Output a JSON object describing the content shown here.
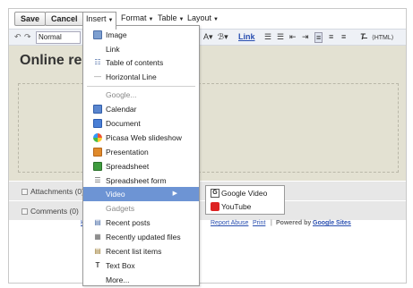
{
  "topbar": {
    "save_label": "Save",
    "cancel_label": "Cancel",
    "menus": [
      "Insert",
      "Format",
      "Table",
      "Layout"
    ]
  },
  "toolbar": {
    "undo_icon": "undo-icon",
    "redo_icon": "redo-icon",
    "style_value": "Normal",
    "link_label": "Link"
  },
  "content": {
    "page_title": "Online res"
  },
  "sections": {
    "attachments": "Attachments (0)",
    "comments": "Comments (0)"
  },
  "footer": {
    "home_fragment": "H",
    "report_abuse": "Report Abuse",
    "print": "Print",
    "powered_by": "Powered by",
    "google_sites": "Google Sites"
  },
  "insert_menu": {
    "items": [
      {
        "label": "Image",
        "icon": "image-icon"
      },
      {
        "label": "Link",
        "icon": ""
      },
      {
        "label": "Table of contents",
        "icon": "toc-icon"
      },
      {
        "label": "Horizontal Line",
        "icon": "horizontal-line-icon"
      }
    ],
    "google_header": "Google...",
    "google_items": [
      {
        "label": "Calendar",
        "icon": "calendar-icon"
      },
      {
        "label": "Document",
        "icon": "document-icon"
      },
      {
        "label": "Picasa Web slideshow",
        "icon": "picasa-icon"
      },
      {
        "label": "Presentation",
        "icon": "presentation-icon"
      },
      {
        "label": "Spreadsheet",
        "icon": "spreadsheet-icon"
      },
      {
        "label": "Spreadsheet form",
        "icon": "spreadsheet-form-icon"
      },
      {
        "label": "Video",
        "icon": ""
      }
    ],
    "gadgets_header": "Gadgets",
    "gadget_items": [
      {
        "label": "Recent posts",
        "icon": "recent-posts-icon"
      },
      {
        "label": "Recently updated files",
        "icon": "recent-files-icon"
      },
      {
        "label": "Recent list items",
        "icon": "recent-list-icon"
      },
      {
        "label": "Text Box",
        "icon": "text-box-icon"
      },
      {
        "label": "More...",
        "icon": ""
      }
    ]
  },
  "video_submenu": {
    "items": [
      {
        "label": "Google Video",
        "icon": "google-video-icon"
      },
      {
        "label": "YouTube",
        "icon": "youtube-icon"
      }
    ]
  },
  "colors": {
    "highlight": "#6d94d4",
    "content_bg": "#e3e1d2",
    "toolbar_bg": "#eef1f6",
    "link": "#2a4fb0"
  }
}
